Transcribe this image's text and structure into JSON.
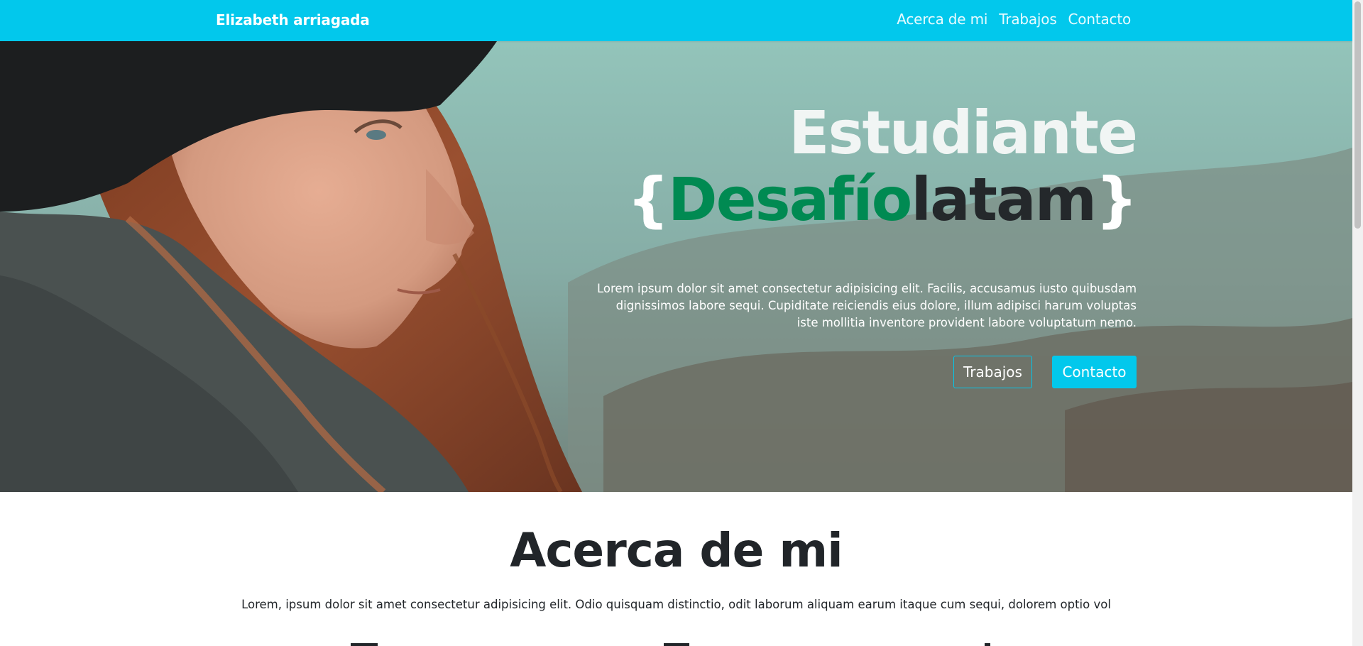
{
  "navbar": {
    "brand": "Elizabeth arriagada",
    "links": [
      "Acerca de mi",
      "Trabajos",
      "Contacto"
    ]
  },
  "hero": {
    "title": "Estudiante",
    "subtitle": {
      "open_brace": "{",
      "highlight": "Desafío",
      "rest": "latam",
      "close_brace": "}"
    },
    "description": "Lorem ipsum dolor sit amet consectetur adipisicing elit. Facilis, accusamus iusto quibusdam dignissimos labore sequi. Cupiditate reiciendis eius dolore, illum adipisci harum voluptas iste mollitia inventore provident labore voluptatum nemo.",
    "buttons": {
      "works": "Trabajos",
      "contact": "Contacto"
    }
  },
  "about": {
    "title": "Acerca de mi",
    "text": "Lorem, ipsum dolor sit amet consectetur adipisicing elit. Odio quisquam distinctio, odit laborum aliquam earum itaque cum sequi, dolorem optio vol"
  },
  "colors": {
    "primary": "#02c8ec",
    "accent_green": "#008a52",
    "dark": "#212529"
  }
}
